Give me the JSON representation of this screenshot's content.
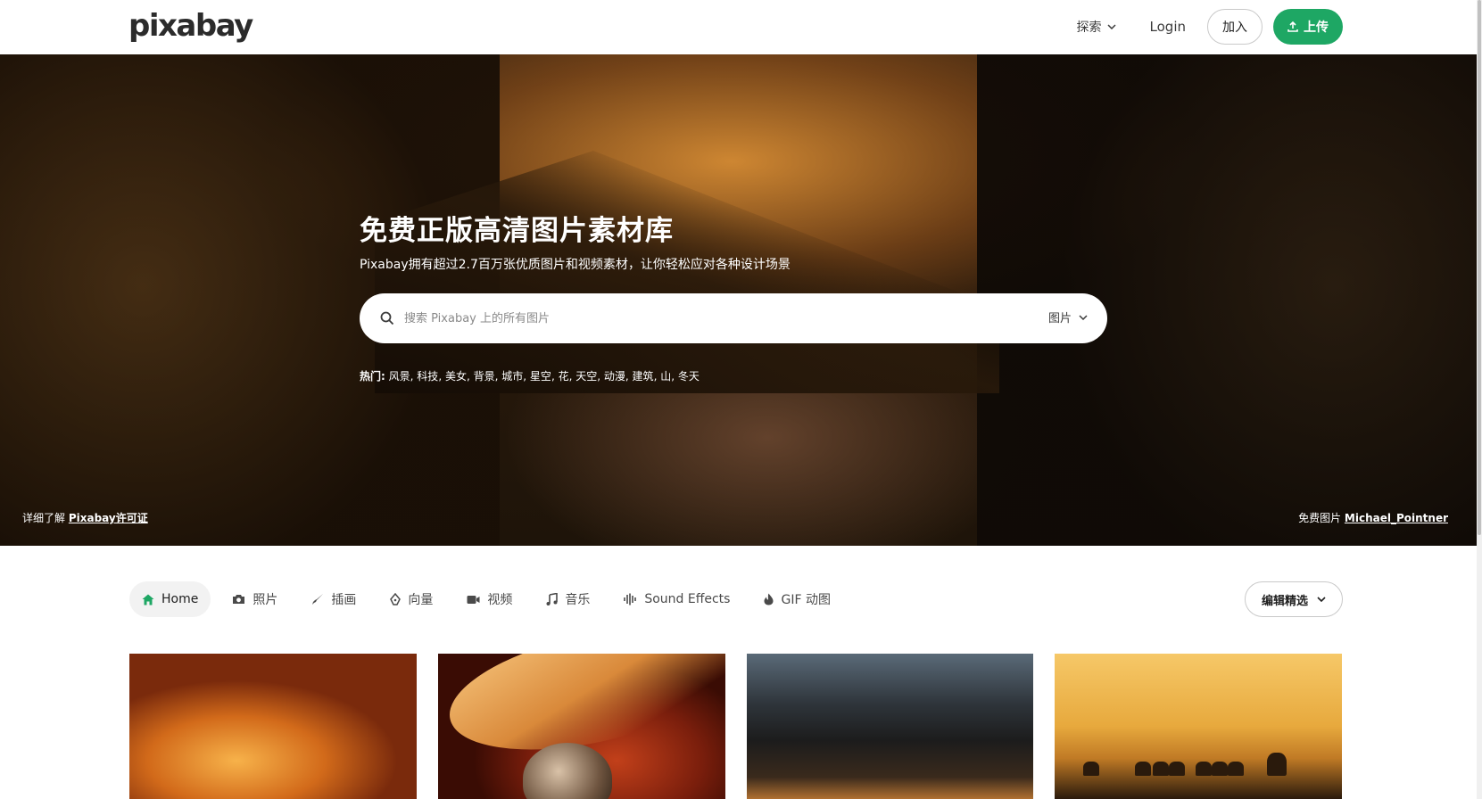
{
  "header": {
    "logo": "pixabay",
    "explore_label": "探索",
    "login_label": "Login",
    "join_label": "加入",
    "upload_label": "上传"
  },
  "hero": {
    "title": "免费正版高清图片素材库",
    "subtitle": "Pixabay拥有超过2.7百万张优质图片和视频素材，让你轻松应对各种设计场景",
    "search": {
      "placeholder": "搜索 Pixabay 上的所有图片",
      "value": "",
      "type_label": "图片"
    },
    "trending": {
      "label": "热门:",
      "items": [
        "风景",
        "科技",
        "美女",
        "背景",
        "城市",
        "星空",
        "花",
        "天空",
        "动漫",
        "建筑",
        "山",
        "冬天"
      ]
    },
    "license": {
      "prefix": "详细了解",
      "link": "Pixabay许可证"
    },
    "credit": {
      "prefix": "免费图片",
      "author": "Michael_Pointner"
    }
  },
  "categories": {
    "items": [
      {
        "label": "Home",
        "icon": "home-icon",
        "active": true
      },
      {
        "label": "照片",
        "icon": "camera-icon",
        "active": false
      },
      {
        "label": "插画",
        "icon": "brush-icon",
        "active": false
      },
      {
        "label": "向量",
        "icon": "pen-nib-icon",
        "active": false
      },
      {
        "label": "视频",
        "icon": "video-camera-icon",
        "active": false
      },
      {
        "label": "音乐",
        "icon": "music-note-icon",
        "active": false
      },
      {
        "label": "Sound Effects",
        "icon": "waveform-icon",
        "active": false
      },
      {
        "label": "GIF 动图",
        "icon": "gif-flame-icon",
        "active": false
      }
    ],
    "sort_label": "编辑精选"
  },
  "colors": {
    "accent": "#1ea764",
    "active_tab_bg": "#f2f2f2",
    "home_icon": "#1ea764"
  }
}
